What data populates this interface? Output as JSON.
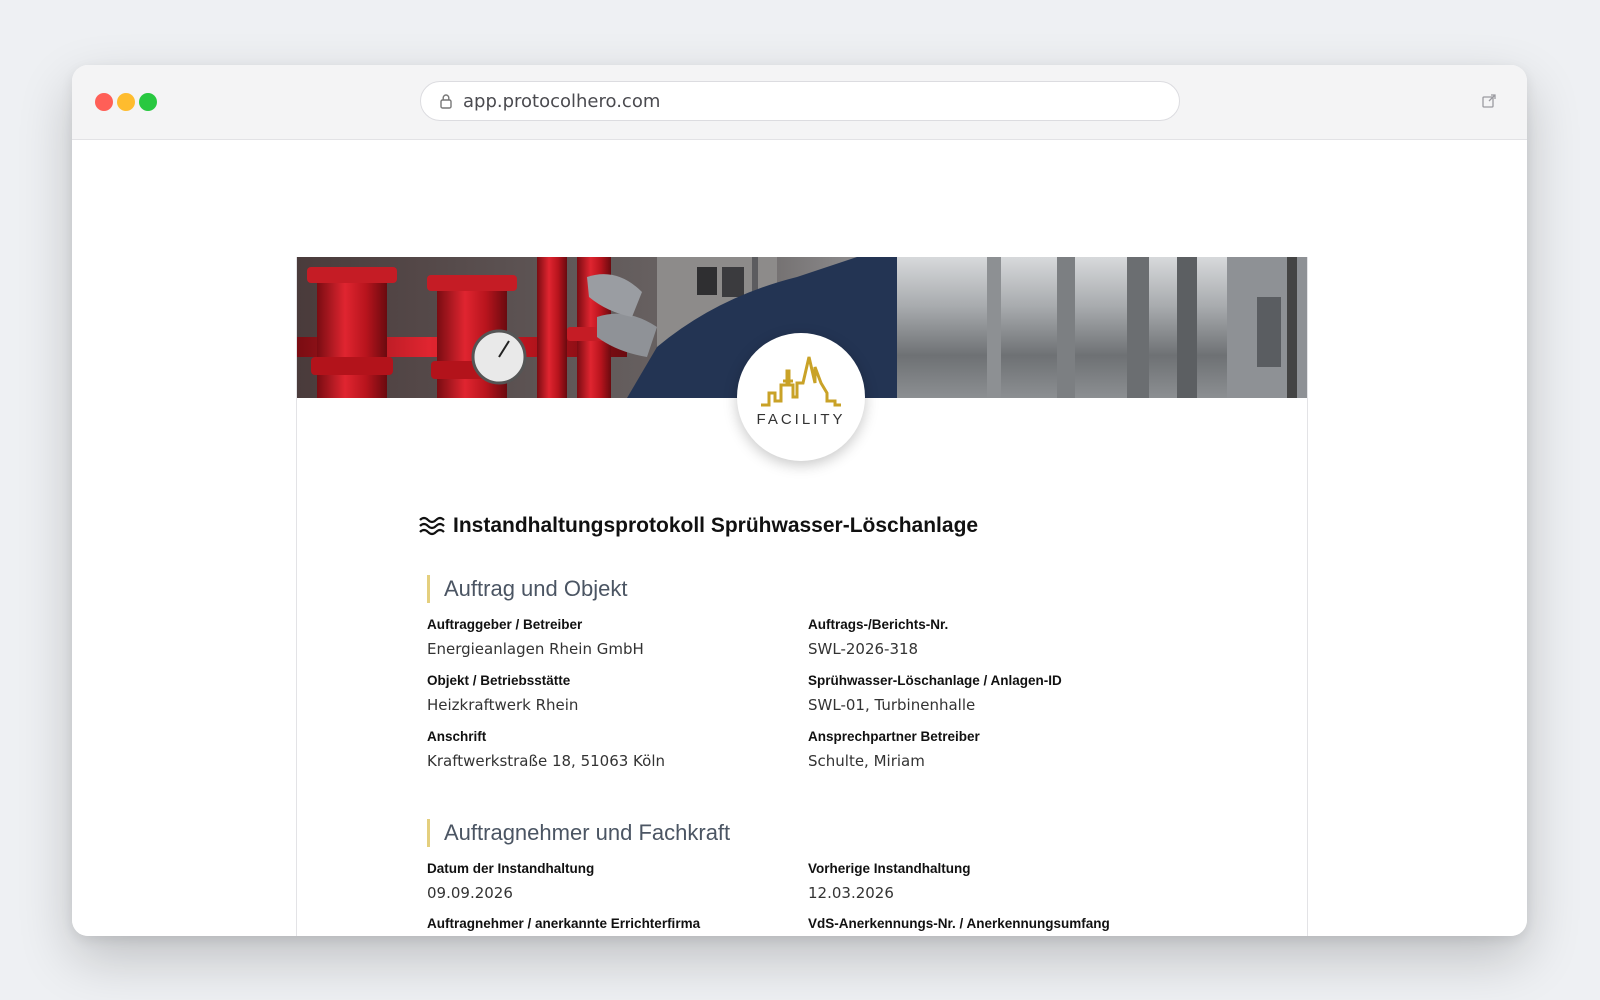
{
  "browser": {
    "url": "app.protocolhero.com"
  },
  "logo": {
    "text": "FACILITY",
    "color": "#c9a227"
  },
  "document": {
    "title": "Instandhaltungsprotokoll Sprühwasser-Löschanlage",
    "sections": [
      {
        "title": "Auftrag und Objekt",
        "fields": [
          {
            "label": "Auftraggeber / Betreiber",
            "value": "Energieanlagen Rhein GmbH"
          },
          {
            "label": "Auftrags-/Berichts-Nr.",
            "value": "SWL-2026-318"
          },
          {
            "label": "Objekt / Betriebsstätte",
            "value": "Heizkraftwerk Rhein"
          },
          {
            "label": "Sprühwasser-Löschanlage / Anlagen-ID",
            "value": "SWL-01, Turbinenhalle"
          },
          {
            "label": "Anschrift",
            "value": "Kraftwerkstraße 18, 51063 Köln"
          },
          {
            "label": "Ansprechpartner Betreiber",
            "value": "Schulte, Miriam"
          }
        ]
      },
      {
        "title": "Auftragnehmer und Fachkraft",
        "fields": [
          {
            "label": "Datum der Instandhaltung",
            "value": "09.09.2026"
          },
          {
            "label": "Vorherige Instandhaltung",
            "value": "12.03.2026"
          },
          {
            "label": "Auftragnehmer / anerkannte Errichterfirma",
            "value": ""
          },
          {
            "label": "VdS-Anerkennungs-Nr. / Anerkennungsumfang",
            "value": ""
          }
        ]
      }
    ]
  }
}
